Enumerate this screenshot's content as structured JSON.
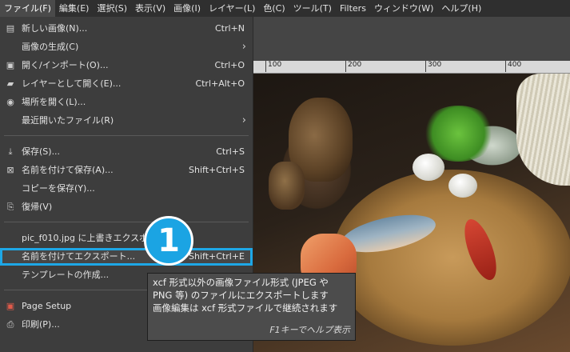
{
  "menubar": {
    "items": [
      {
        "label": "ファイル(F)"
      },
      {
        "label": "編集(E)"
      },
      {
        "label": "選択(S)"
      },
      {
        "label": "表示(V)"
      },
      {
        "label": "画像(I)"
      },
      {
        "label": "レイヤー(L)"
      },
      {
        "label": "色(C)"
      },
      {
        "label": "ツール(T)"
      },
      {
        "label": "Filters"
      },
      {
        "label": "ウィンドウ(W)"
      },
      {
        "label": "ヘルプ(H)"
      }
    ]
  },
  "ruler": {
    "labels": [
      "100",
      "200",
      "300",
      "400"
    ]
  },
  "file_menu": {
    "items": [
      {
        "label": "新しい画像(N)...",
        "shortcut": "Ctrl+N",
        "icon": "new-image-icon"
      },
      {
        "label": "画像の生成(C)",
        "shortcut": "",
        "submenu": true
      },
      {
        "label": "開く/インポート(O)...",
        "shortcut": "Ctrl+O",
        "icon": "open-icon"
      },
      {
        "label": "レイヤーとして開く(E)...",
        "shortcut": "Ctrl+Alt+O",
        "icon": "open-as-layer-icon"
      },
      {
        "label": "場所を開く(L)...",
        "shortcut": "",
        "icon": "globe-icon"
      },
      {
        "label": "最近開いたファイル(R)",
        "shortcut": "",
        "submenu": true
      },
      {
        "label": "保存(S)...",
        "shortcut": "Ctrl+S",
        "icon": "save-icon"
      },
      {
        "label": "名前を付けて保存(A)...",
        "shortcut": "Shift+Ctrl+S",
        "icon": "save-as-icon"
      },
      {
        "label": "コピーを保存(Y)...",
        "shortcut": ""
      },
      {
        "label": "復帰(V)",
        "shortcut": "",
        "icon": "revert-icon"
      },
      {
        "label": "pic_f010.jpg に上書きエクスポート",
        "shortcut": ""
      },
      {
        "label": "名前を付けてエクスポート...",
        "shortcut": "Shift+Ctrl+E"
      },
      {
        "label": "テンプレートの作成...",
        "shortcut": ""
      },
      {
        "label": "Page Setup",
        "shortcut": "",
        "icon": "page-setup-icon"
      },
      {
        "label": "印刷(P)...",
        "shortcut": "",
        "icon": "print-icon"
      }
    ]
  },
  "badge": {
    "number": "1"
  },
  "tooltip": {
    "lines": [
      "xcf 形式以外の画像ファイル形式 (JPEG や",
      "PNG 等) のファイルにエクスポートします",
      "画像編集は xcf 形式ファイルで継続されます"
    ],
    "hint": "F1キーでヘルプ表示"
  },
  "colors": {
    "highlight": "#1ea7e6",
    "badge": "#1ba4e3"
  }
}
